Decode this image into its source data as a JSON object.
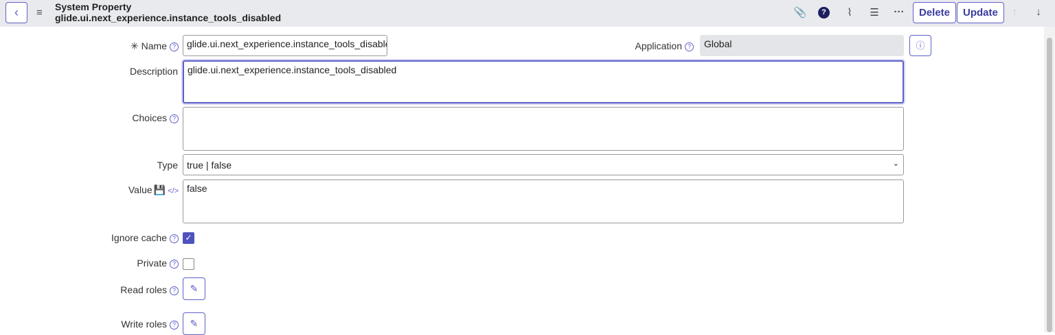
{
  "header": {
    "title": "System Property",
    "subtitle": "glide.ui.next_experience.instance_tools_disabled",
    "delete_label": "Delete",
    "update_label": "Update",
    "icons": [
      "paperclip-icon",
      "help-icon",
      "activity-icon",
      "settings-sliders-icon",
      "more-icon",
      "arrow-up-icon",
      "arrow-down-icon"
    ]
  },
  "form": {
    "name": {
      "label": "Name",
      "value": "glide.ui.next_experience.instance_tools_disabled"
    },
    "application": {
      "label": "Application",
      "value": "Global"
    },
    "description": {
      "label": "Description",
      "value": "glide.ui.next_experience.instance_tools_disabled"
    },
    "choices": {
      "label": "Choices",
      "value": ""
    },
    "type": {
      "label": "Type",
      "value": "true | false"
    },
    "value": {
      "label": "Value",
      "value": "false"
    },
    "ignore_cache": {
      "label": "Ignore cache",
      "checked": true
    },
    "private": {
      "label": "Private",
      "checked": false
    },
    "read_roles": {
      "label": "Read roles"
    },
    "write_roles": {
      "label": "Write roles"
    }
  },
  "colors": {
    "accent": "#5d5fc9",
    "header_bg": "#e9eaee"
  }
}
